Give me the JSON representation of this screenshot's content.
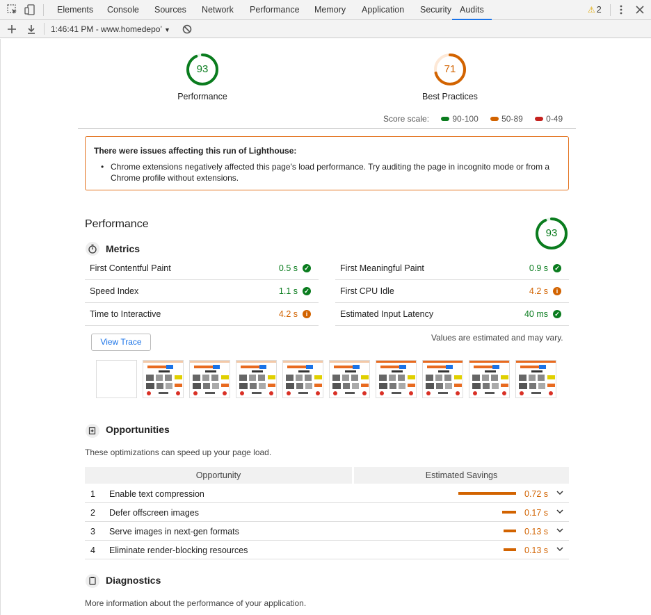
{
  "devtools": {
    "tabs": [
      "Elements",
      "Console",
      "Sources",
      "Network",
      "Performance",
      "Memory",
      "Application",
      "Security",
      "Audits"
    ],
    "active_tab": "Audits",
    "warnings_count": "2",
    "report_label": "1:46:41 PM - www.homedepo’"
  },
  "gauges": [
    {
      "score": "93",
      "label": "Performance",
      "color": "#0a7c1e"
    },
    {
      "score": "71",
      "label": "Best Practices",
      "color": "#d26300"
    }
  ],
  "score_scale": {
    "label": "Score scale:",
    "ranges": [
      {
        "text": "90-100",
        "color": "#0a7c1e"
      },
      {
        "text": "50-89",
        "color": "#d26300"
      },
      {
        "text": "0-49",
        "color": "#c5221f"
      }
    ]
  },
  "warning": {
    "title": "There were issues affecting this run of Lighthouse:",
    "bullet": "Chrome extensions negatively affected this page's load performance. Try auditing the page in incognito mode or from a Chrome profile without extensions."
  },
  "performance": {
    "title": "Performance",
    "score": "93",
    "metrics_title": "Metrics",
    "metrics": [
      {
        "name": "First Contentful Paint",
        "value": "0.5 s",
        "status": "pass"
      },
      {
        "name": "First Meaningful Paint",
        "value": "0.9 s",
        "status": "pass"
      },
      {
        "name": "Speed Index",
        "value": "1.1 s",
        "status": "pass"
      },
      {
        "name": "First CPU Idle",
        "value": "4.2 s",
        "status": "average"
      },
      {
        "name": "Time to Interactive",
        "value": "4.2 s",
        "status": "average"
      },
      {
        "name": "Estimated Input Latency",
        "value": "40 ms",
        "status": "pass"
      }
    ],
    "view_trace": "View Trace",
    "note": "Values are estimated and may vary."
  },
  "opportunities": {
    "title": "Opportunities",
    "description": "These optimizations can speed up your page load.",
    "col_opportunity": "Opportunity",
    "col_savings": "Estimated Savings",
    "rows": [
      {
        "index": "1",
        "label": "Enable text compression",
        "savings": "0.72 s",
        "fraction": 1.0
      },
      {
        "index": "2",
        "label": "Defer offscreen images",
        "savings": "0.17 s",
        "fraction": 0.24
      },
      {
        "index": "3",
        "label": "Serve images in next-gen formats",
        "savings": "0.13 s",
        "fraction": 0.18
      },
      {
        "index": "4",
        "label": "Eliminate render-blocking resources",
        "savings": "0.13 s",
        "fraction": 0.18
      }
    ]
  },
  "diagnostics": {
    "title": "Diagnostics",
    "description": "More information about the performance of your application."
  }
}
